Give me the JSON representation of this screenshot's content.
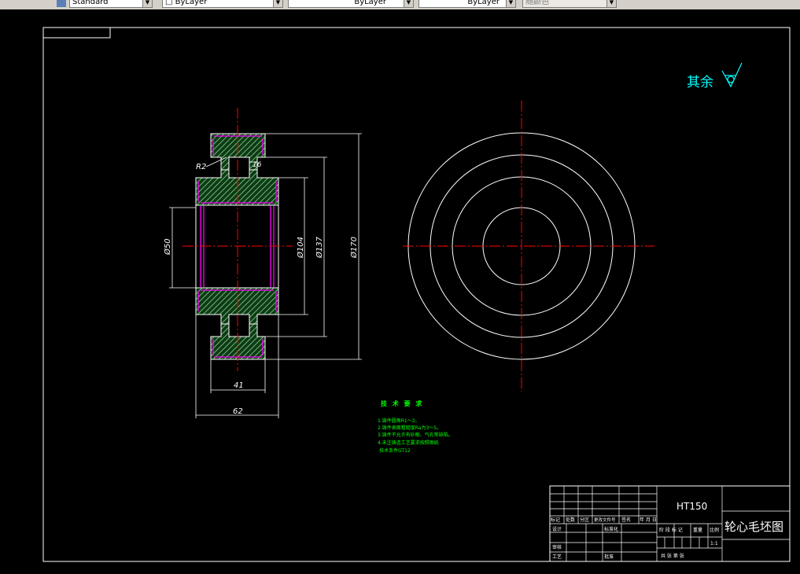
{
  "toolbar": {
    "text_style": "Standard",
    "layer": "ByLayer",
    "linetype": "ByLayer",
    "lineweight": "ByLayer",
    "plot_style": "随颜色"
  },
  "drawing": {
    "roughness_note": "其余",
    "dims": {
      "r2": "R2",
      "d16": "16",
      "phi50": "Ø50",
      "phi104": "Ø104",
      "phi137": "Ø137",
      "phi170": "Ø170",
      "w41": "41",
      "w62": "62"
    },
    "tech_requirements": {
      "title": "技 术 要 求",
      "lines": [
        "1.铸件圆角R1～2。",
        "2.铸件表面粗糙度Ra为3～5。",
        "3.铸件不允许有砂眼、气孔等缺陷。",
        "4.未注铸造工艺要求按照图纸",
        "技术条件GT12"
      ]
    }
  },
  "title_block": {
    "material": "HT150",
    "drawing_name": "轮心毛坯图",
    "header_row": [
      "标记",
      "处数",
      "分区",
      "更改文件号",
      "签名",
      "年 月 日"
    ],
    "labels": {
      "design": "设计",
      "standardization": "标准化",
      "check": "审核",
      "process": "工艺",
      "approve": "批准",
      "stage_mark": "阶 段 标 记",
      "weight": "重量",
      "scale": "比例",
      "scale_value": "1:1",
      "sheets": "共  张 第  张"
    }
  }
}
